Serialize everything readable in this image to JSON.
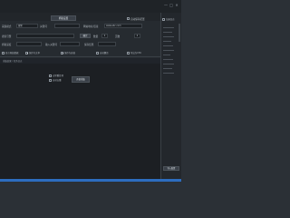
{
  "window": {
    "title": "",
    "controls": {
      "minimize": "—",
      "maximize": "□",
      "close": "✕"
    }
  },
  "top": {
    "tab_label": "抓取设置",
    "auto_check_label": "自动保存配置"
  },
  "row1": {
    "label_a": "采集模式",
    "field_a": "搜索",
    "label_b": "关键词",
    "label_c": "网站地址/链接",
    "field_c": "www.abc.com"
  },
  "row2": {
    "label_a": "搜索引擎",
    "field_a": "",
    "btn": "确定",
    "label_b": "数量",
    "spin_b": "0",
    "label_c": "页数",
    "spin_c": "0"
  },
  "row3": {
    "label_a": "抓取深度",
    "label_b": "输入关键词",
    "label_c": "保存结果"
  },
  "row4": {
    "checks": [
      {
        "label": "显示原始数据",
        "checked": false
      },
      {
        "label": "保存为文本",
        "checked": true
      },
      {
        "label": "保存为表格",
        "checked": true
      },
      {
        "label": "自动翻页",
        "checked": false
      },
      {
        "label": "导出为CSV",
        "checked": false
      }
    ]
  },
  "section": {
    "title": "采集结果 / 任务日志"
  },
  "main": {
    "checks": [
      {
        "label": "去除重复项",
        "checked": false
      },
      {
        "label": "自动去重",
        "checked": false
      }
    ],
    "start_button": "开始采集"
  },
  "right_panel": {
    "check_label": "记录日志",
    "button": "导入配置"
  }
}
